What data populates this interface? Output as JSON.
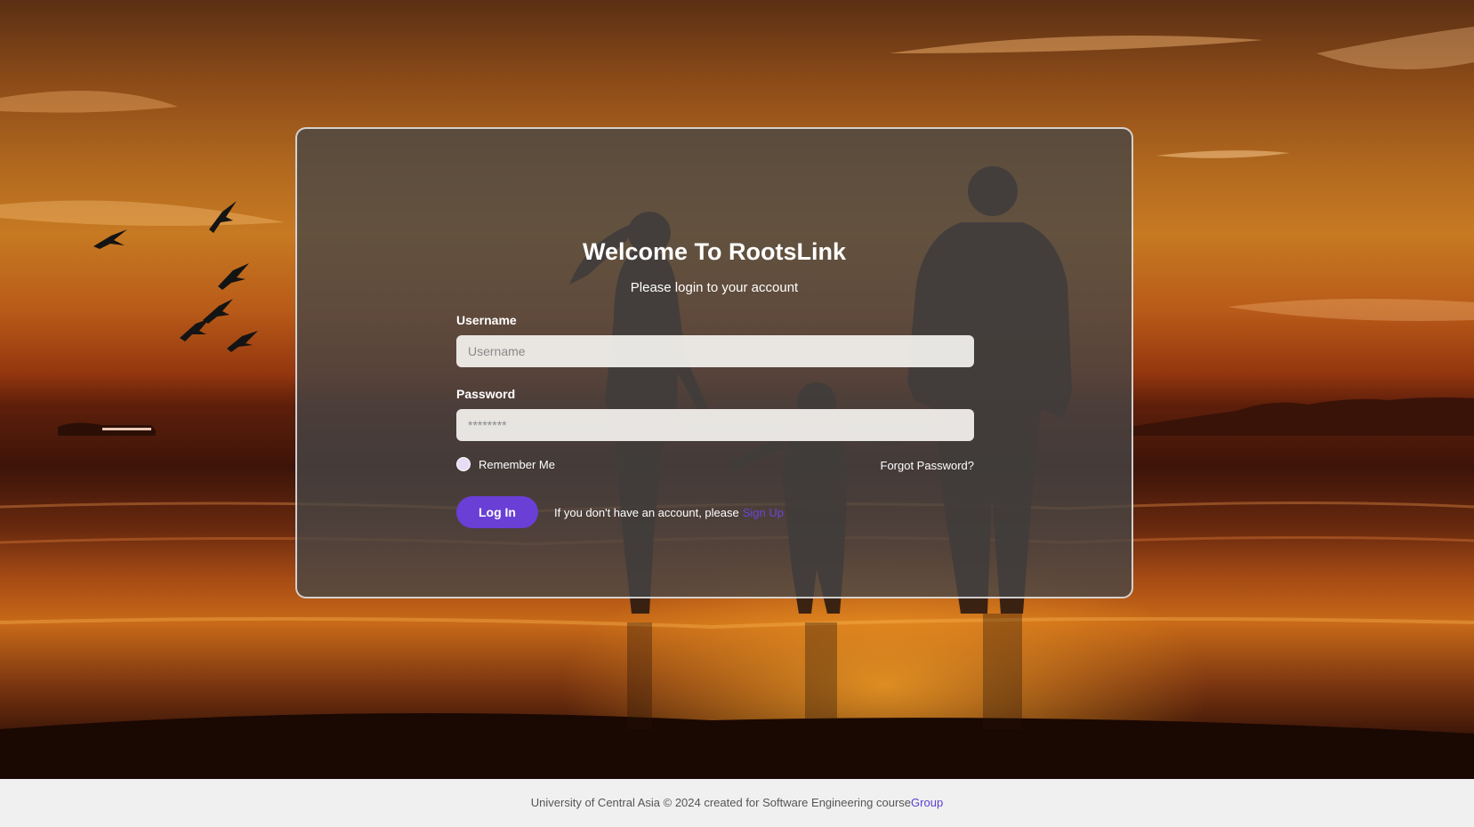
{
  "login": {
    "title": "Welcome To RootsLink",
    "subtitle": "Please login to your account",
    "username_label": "Username",
    "username_placeholder": "Username",
    "password_label": "Password",
    "password_placeholder": "********",
    "remember_label": "Remember Me",
    "forgot_label": "Forgot Password?",
    "login_button": "Log In",
    "signup_prompt": "If you don't have an account, please",
    "signup_link": "Sign Up"
  },
  "footer": {
    "text": "University of Central Asia © 2024 created for Software Engineering course",
    "link": "Group"
  },
  "colors": {
    "accent": "#6a3fd6",
    "card_bg": "#464646",
    "footer_bg": "#f0f0f0"
  },
  "icons": {
    "remember": "radio-circle-icon"
  }
}
